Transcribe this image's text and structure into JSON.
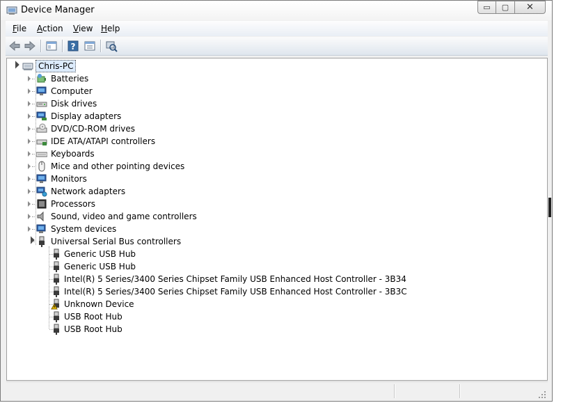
{
  "window": {
    "title": "Device Manager"
  },
  "window_buttons": {
    "minimize": "▭",
    "maximize": "▢",
    "close": "✕"
  },
  "menu": [
    {
      "label": "File",
      "accel": "F",
      "rest": "ile"
    },
    {
      "label": "Action",
      "accel": "A",
      "rest": "ction"
    },
    {
      "label": "View",
      "accel": "V",
      "rest": "iew"
    },
    {
      "label": "Help",
      "accel": "H",
      "rest": "elp"
    }
  ],
  "toolbar": {
    "icons": [
      "back-arrow-icon",
      "forward-arrow-icon",
      "show-hide-console-tree-icon",
      "help-icon",
      "properties-icon",
      "scan-hardware-changes-icon"
    ]
  },
  "tree": {
    "root": {
      "label": "Chris-PC",
      "icon": "computer-icon"
    },
    "categories": [
      {
        "label": "Batteries",
        "icon": "battery-icon"
      },
      {
        "label": "Computer",
        "icon": "monitor-icon"
      },
      {
        "label": "Disk drives",
        "icon": "disk-drive-icon"
      },
      {
        "label": "Display adapters",
        "icon": "display-adapter-icon"
      },
      {
        "label": "DVD/CD-ROM drives",
        "icon": "dvd-drive-icon"
      },
      {
        "label": "IDE ATA/ATAPI controllers",
        "icon": "ide-controller-icon"
      },
      {
        "label": "Keyboards",
        "icon": "keyboard-icon"
      },
      {
        "label": "Mice and other pointing devices",
        "icon": "mouse-icon"
      },
      {
        "label": "Monitors",
        "icon": "monitor-icon"
      },
      {
        "label": "Network adapters",
        "icon": "network-adapter-icon"
      },
      {
        "label": "Processors",
        "icon": "processor-icon"
      },
      {
        "label": "Sound, video and game controllers",
        "icon": "speaker-icon"
      },
      {
        "label": "System devices",
        "icon": "system-device-icon"
      },
      {
        "label": "Universal Serial Bus controllers",
        "icon": "usb-icon"
      }
    ],
    "usb_children": [
      {
        "label": "Generic USB Hub",
        "icon": "usb-plug-icon"
      },
      {
        "label": "Generic USB Hub",
        "icon": "usb-plug-icon"
      },
      {
        "label": "Intel(R) 5 Series/3400 Series Chipset Family USB Enhanced Host Controller - 3B34",
        "icon": "usb-plug-icon"
      },
      {
        "label": "Intel(R) 5 Series/3400 Series Chipset Family USB Enhanced Host Controller - 3B3C",
        "icon": "usb-plug-icon"
      },
      {
        "label": "Unknown Device",
        "icon": "warning-usb-icon"
      },
      {
        "label": "USB Root Hub",
        "icon": "usb-plug-icon"
      },
      {
        "label": "USB Root Hub",
        "icon": "usb-plug-icon"
      }
    ]
  },
  "colors": {
    "selection": "#dcebfc",
    "accent": "#3a6ea5",
    "warning": "#f2c200"
  }
}
